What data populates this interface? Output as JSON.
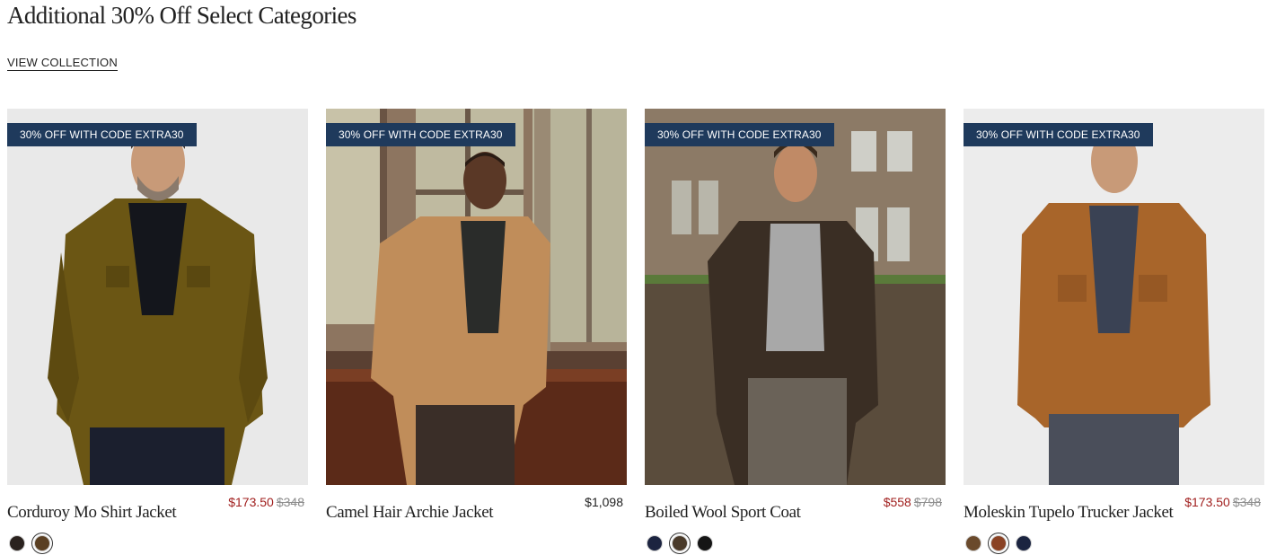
{
  "header": {
    "title": "Additional 30% Off Select Categories",
    "view_collection_label": "VIEW COLLECTION"
  },
  "products": [
    {
      "badge": "30% OFF WITH CODE EXTRA30",
      "name": "Corduroy Mo Shirt Jacket",
      "sale_price": "$173.50",
      "original_price": "$348",
      "swatches": [
        {
          "color": "#2a221e",
          "selected": false
        },
        {
          "color": "#5a3f22",
          "selected": true
        }
      ]
    },
    {
      "badge": "30% OFF WITH CODE EXTRA30",
      "name": "Camel Hair Archie Jacket",
      "price": "$1,098",
      "swatches": []
    },
    {
      "badge": "30% OFF WITH CODE EXTRA30",
      "name": "Boiled Wool Sport Coat",
      "sale_price": "$558",
      "original_price": "$798",
      "swatches": [
        {
          "color": "#1c2440",
          "selected": false
        },
        {
          "color": "#4a3a2a",
          "selected": true
        },
        {
          "color": "#151515",
          "selected": false
        }
      ]
    },
    {
      "badge": "30% OFF WITH CODE EXTRA30",
      "name": "Moleskin Tupelo Trucker Jacket",
      "sale_price": "$173.50",
      "original_price": "$348",
      "swatches": [
        {
          "color": "#6a4a2c",
          "selected": false
        },
        {
          "color": "#8a4224",
          "selected": true
        },
        {
          "color": "#1b2440",
          "selected": false
        }
      ]
    }
  ],
  "colors": {
    "badge_bg": "#1f3a5c",
    "sale_price": "#a1201f",
    "original_price": "#8d8d8d"
  }
}
